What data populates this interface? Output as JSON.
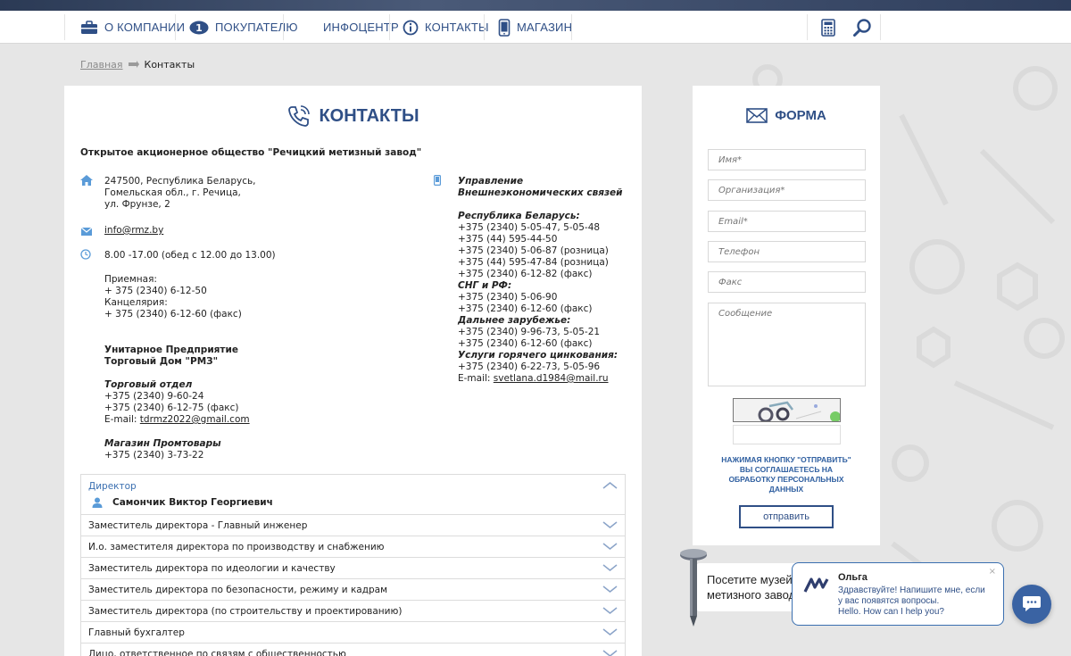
{
  "nav": {
    "items": [
      {
        "label": "О КОМПАНИИ",
        "icon": "briefcase-icon"
      },
      {
        "label": "ПОКУПАТЕЛЮ",
        "icon": "badge-one-icon"
      },
      {
        "label": "ИНФОЦЕНТР"
      },
      {
        "label": "КОНТАКТЫ",
        "icon": "info-icon"
      },
      {
        "label": "МАГАЗИН",
        "icon": "phone-icon"
      }
    ]
  },
  "breadcrumb": {
    "home": "Главная",
    "current": "Контакты"
  },
  "page": {
    "title": "КОНТАКТЫ"
  },
  "contacts": {
    "company": "Открытое акционерное общество \"Речицкий метизный завод\"",
    "address": [
      "247500, Республика Беларусь,",
      "Гомельская обл.,  г. Речица,",
      "ул. Фрунзе, 2"
    ],
    "email": "info@rmz.by",
    "hours": "8.00 -17.00 (обед с 12.00 до 13.00)",
    "reception_label": "Приемная:",
    "reception_phone": "+ 375 (2340) 6-12-50",
    "office_label": "Канцелярия:",
    "office_phone": "+ 375 (2340) 6-12-60 (факс)",
    "td_name": [
      "Унитарное Предприятие",
      "Торговый Дом \"РМЗ\""
    ],
    "sales_label": "Торговый отдел",
    "sales_phones": [
      "+375 (2340) 9-60-24",
      "+375 (2340) 6-12-75 (факс)"
    ],
    "sales_email_label": "E-mail: ",
    "sales_email": "tdrmz2022@gmail.com",
    "shop_label": "Магазин Промтовары",
    "shop_phone": "+375 (2340) 3-73-22",
    "fea_title": [
      "Управление",
      "Внешнеэкономических связей"
    ],
    "rb_label": "Республика Беларусь:",
    "rb_phones": [
      "+375 (2340) 5-05-47, 5-05-48",
      "+375 (44) 595-44-50",
      "+375 (2340) 5-06-87 (розница)",
      "+375 (44) 595-47-84 (розница)",
      "+375 (2340) 6-12-82 (факс)"
    ],
    "cis_label": "СНГ и РФ:",
    "cis_phones": [
      "+375 (2340) 5-06-90",
      "+375 (2340) 6-12-60 (факс)"
    ],
    "far_label": "Дальнее зарубежье:",
    "far_phones": [
      "+375 (2340) 9-96-73, 5-05-21",
      "+375 (2340) 6-12-60 (факс)"
    ],
    "galv_label": "Услуги горячего цинкования:",
    "galv_phone": "+375 (2340) 6-22-73, 5-05-96",
    "galv_email_label": "E-mail: ",
    "galv_email": " svetlana.d1984@mail.ru"
  },
  "accordion": {
    "open": {
      "title": "Директор",
      "name": "Самончик Виктор Георгиевич"
    },
    "rows": [
      "Заместитель директора - Главный инженер",
      "И.о. заместителя директора по производству и снабжению",
      "Заместитель директора по идеологии и качеству",
      "Заместитель директора по безопасности, режиму и кадрам",
      "Заместитель директора (по строительству и проектированию)",
      "Главный бухгалтер",
      "Лицо, ответственное по связям с общественностью"
    ]
  },
  "form": {
    "title": "ФОРМА",
    "name_ph": "Имя*",
    "org_ph": "Организация*",
    "email_ph": "Email*",
    "phone_ph": "Телефон",
    "fax_ph": "Факс",
    "message_ph": "Сообщение",
    "consent": "НАЖИМАЯ КНОПКУ \"ОТПРАВИТЬ\" ВЫ СОГЛАШАЕТЕСЬ НА ОБРАБОТКУ ПЕРСОНАЛЬНЫХ ДАННЫХ",
    "submit": "отправить"
  },
  "museum": {
    "lines": [
      "Посетите музей",
      "метизного завода"
    ]
  },
  "chat": {
    "name": "Ольга",
    "message": [
      "Здравствуйте! Напишите мне, если",
      "у вас появятся вопросы.",
      "Hello. How can I help you?"
    ],
    "close": "×"
  },
  "colors": {
    "accent": "#2f4f86",
    "link_blue": "#3a6fb0",
    "chat_button": "#3a63a3"
  }
}
